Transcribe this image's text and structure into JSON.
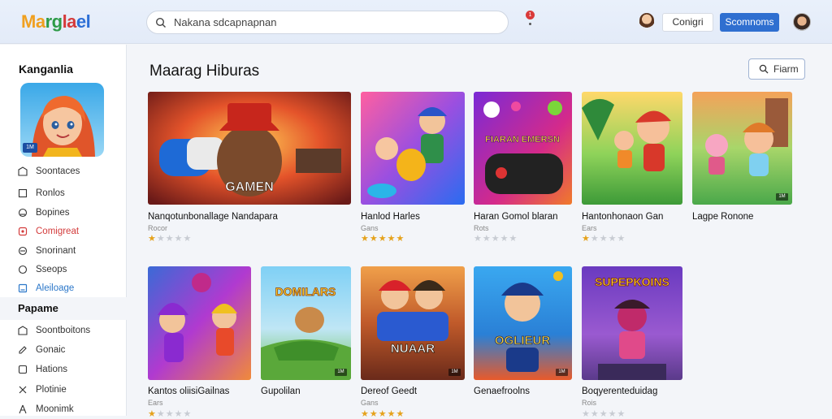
{
  "header": {
    "logo_parts": [
      "Ma",
      "rg",
      "la",
      "el"
    ],
    "search_placeholder": "Nakana sdcapnapnan",
    "notif_count": "1",
    "login_label": "Conigri",
    "signup_label": "Scomnoms"
  },
  "sidebar": {
    "title": "Kanganlia",
    "art_badge": "1M",
    "items": [
      {
        "label": "Soontaces",
        "icon": "grid-icon"
      },
      {
        "label": "Ronlos",
        "icon": "square-icon"
      },
      {
        "label": "Bopines",
        "icon": "circle-icon"
      },
      {
        "label": "Comigreat",
        "icon": "bookmark-icon",
        "color": "#d33b3b"
      },
      {
        "label": "Snorinant",
        "icon": "chat-icon"
      },
      {
        "label": "Sseops",
        "icon": "circle-icon"
      },
      {
        "label": "Aleiloage",
        "icon": "card-icon",
        "color": "#2b77c9"
      }
    ],
    "section_title": "Papame",
    "section_items": [
      {
        "label": "Soontboitons",
        "icon": "grid-icon"
      },
      {
        "label": "Gonaic",
        "icon": "pen-icon"
      },
      {
        "label": "Hations",
        "icon": "square-icon"
      },
      {
        "label": "Plotinie",
        "icon": "x-icon"
      },
      {
        "label": "Moonimk",
        "icon": "tool-icon"
      }
    ]
  },
  "main": {
    "title": "Maarag Hiburas",
    "filter_label": "Fiarm",
    "games": [
      {
        "title": "Nanqotunbonallage Nandapara",
        "sub": "Rocor",
        "rating": 1,
        "art": "GAMEN",
        "tag": ""
      },
      {
        "title": "Hanlod Harles",
        "sub": "Gans",
        "rating": 5,
        "art": "",
        "tag": ""
      },
      {
        "title": "Haran Gomol blaran",
        "sub": "Rots",
        "rating": 0,
        "art": "FIARAN EMERSN",
        "tag": ""
      },
      {
        "title": "Hantonhonaon Gan",
        "sub": "Ears",
        "rating": 1,
        "art": "",
        "tag": ""
      },
      {
        "title": "Lagpe Ronone",
        "sub": "",
        "rating": 0,
        "art": "",
        "tag": "1M"
      },
      {
        "title": "Kantos oliisiGailnas",
        "sub": "Ears",
        "rating": 1,
        "art": "",
        "tag": ""
      },
      {
        "title": "Gupolilan",
        "sub": "",
        "rating": 0,
        "art": "DOMILARS",
        "tag": "1M"
      },
      {
        "title": "Dereof Geedt",
        "sub": "Gans",
        "rating": 5,
        "art": "NUAAR",
        "tag": "1M"
      },
      {
        "title": "Genaefroolns",
        "sub": "",
        "rating": 0,
        "art": "OGLIEUR",
        "tag": "1M"
      },
      {
        "title": "Boqyerenteduidag",
        "sub": "Rois",
        "rating": 0,
        "art": "SUPEPKOINS",
        "tag": ""
      }
    ]
  }
}
